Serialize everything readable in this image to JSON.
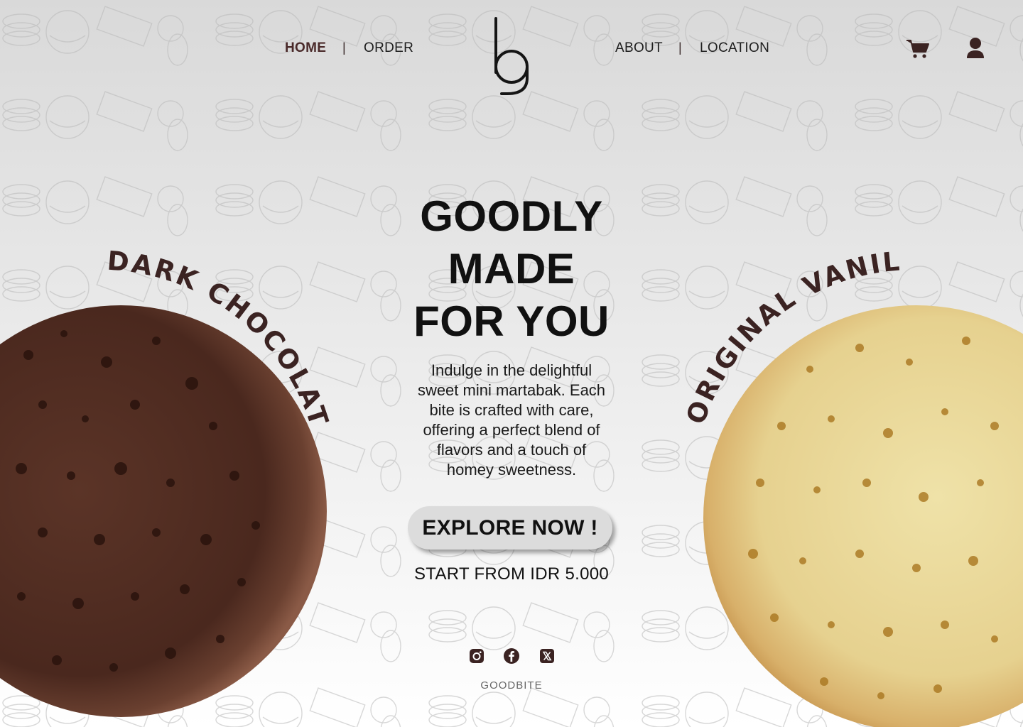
{
  "nav": {
    "left": [
      {
        "label": "HOME",
        "active": true
      },
      {
        "label": "ORDER",
        "active": false
      }
    ],
    "right": [
      {
        "label": "ABOUT",
        "active": false
      },
      {
        "label": "LOCATION",
        "active": false
      }
    ],
    "separator": "|",
    "logo_text": "bg",
    "cart_icon": "cart-icon",
    "user_icon": "user-icon"
  },
  "hero": {
    "headline": [
      "GOODLY",
      "MADE",
      "FOR YOU"
    ],
    "description_lines": [
      "Indulge in the delightful",
      "sweet mini martabak. Each",
      "bite is crafted with care,",
      "offering a perfect blend of",
      "flavors and a touch of",
      "homey sweetness."
    ],
    "cta_label": "EXPLORE NOW !",
    "price_text": "START FROM IDR 5.000"
  },
  "products": {
    "left_label": "DARK CHOCOLATE",
    "right_label": "ORIGINAL VANILLA"
  },
  "footer": {
    "social": [
      "instagram-icon",
      "facebook-icon",
      "x-icon"
    ],
    "brand": "GOODBITE"
  },
  "colors": {
    "accent": "#4a2a2a",
    "text_dark": "#111111",
    "button_bg": "#dcdcdc",
    "chocolate": "#5a3428",
    "vanilla": "#e8d79a"
  }
}
